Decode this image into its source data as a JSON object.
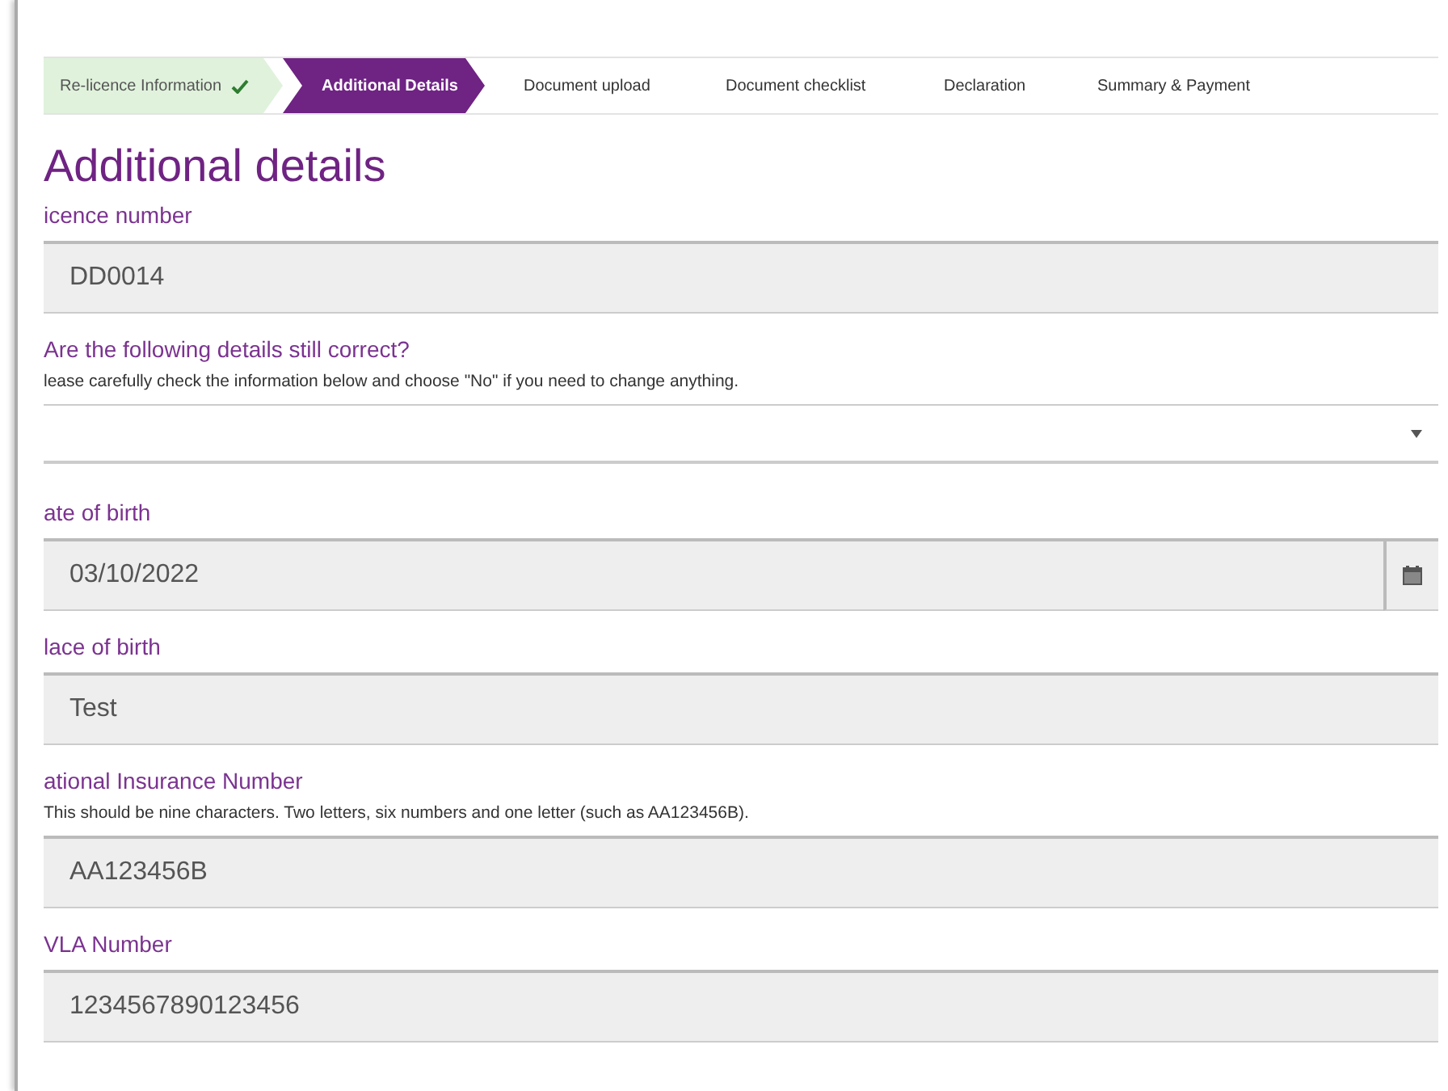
{
  "steps": [
    {
      "label": "Re-licence Information",
      "completed": true,
      "selected": false
    },
    {
      "label": "Additional Details",
      "completed": false,
      "selected": true
    },
    {
      "label": "Document upload",
      "completed": false,
      "selected": false
    },
    {
      "label": "Document checklist",
      "completed": false,
      "selected": false
    },
    {
      "label": "Declaration",
      "completed": false,
      "selected": false
    },
    {
      "label": "Summary & Payment",
      "completed": false,
      "selected": false
    }
  ],
  "heading": "Additional details",
  "fields": [
    {
      "kind": "text",
      "label": "icence number",
      "value": "DD0014"
    },
    {
      "kind": "select",
      "label": "Are the following details still correct?",
      "hint": "lease carefully check the information below and choose \"No\" if you need to change anything."
    },
    {
      "kind": "date",
      "label": "ate of birth",
      "value": "03/10/2022"
    },
    {
      "kind": "text",
      "label": "lace of birth",
      "value": "Test"
    },
    {
      "kind": "text",
      "label": "ational Insurance Number",
      "hint": "This should be nine characters. Two letters, six numbers and one letter (such as AA123456B).",
      "value": "AA123456B"
    },
    {
      "kind": "text",
      "label": "VLA Number",
      "value": "1234567890123456"
    }
  ]
}
